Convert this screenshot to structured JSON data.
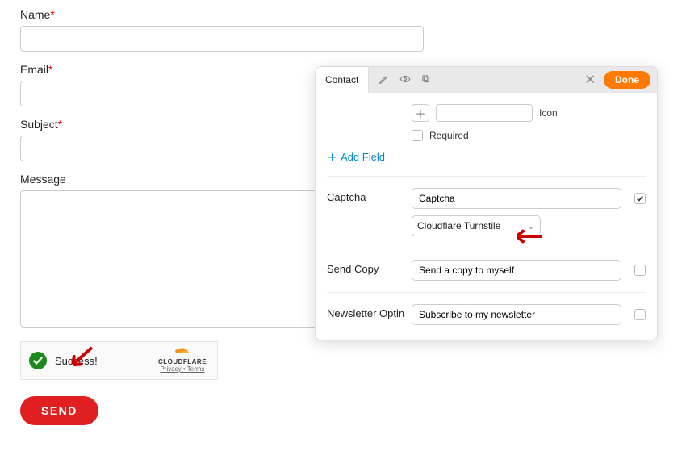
{
  "form": {
    "name_label": "Name",
    "email_label": "Email",
    "subject_label": "Subject",
    "message_label": "Message",
    "required_mark": "*",
    "name_value": "",
    "email_value": "",
    "subject_value": "",
    "message_value": "",
    "send_label": "SEND"
  },
  "turnstile": {
    "success": "Success!",
    "brand": "CLOUDFLARE",
    "privacy": "Privacy",
    "terms": "Terms",
    "sep": " • "
  },
  "panel": {
    "tab": "Contact",
    "done": "Done",
    "icon_label": "Icon",
    "required_label": "Required",
    "add_field": "Add Field",
    "sections": {
      "captcha": {
        "label": "Captcha",
        "input_value": "Captcha",
        "select_value": "Cloudflare Turnstile",
        "checked": true
      },
      "sendcopy": {
        "label": "Send Copy",
        "input_value": "Send a copy to myself",
        "checked": false
      },
      "newsletter": {
        "label": "Newsletter Optin",
        "input_value": "Subscribe to my newsletter",
        "checked": false
      }
    }
  }
}
